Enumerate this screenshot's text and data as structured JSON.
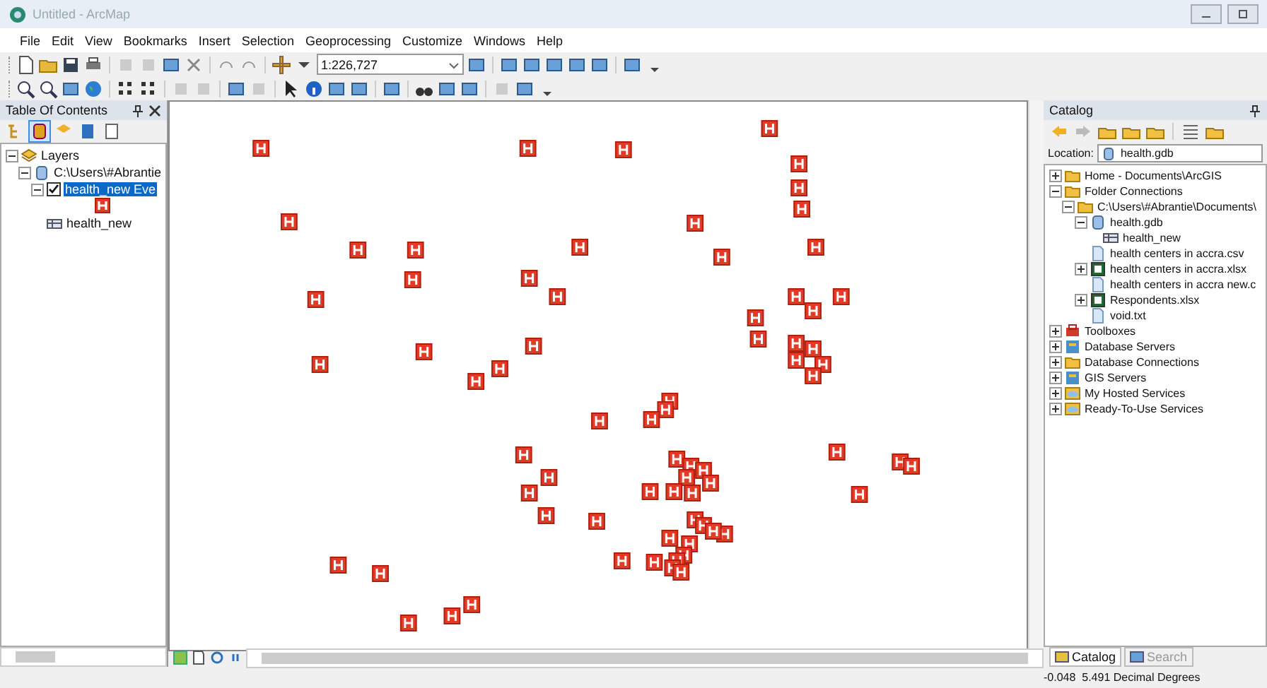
{
  "window": {
    "title": "Untitled - ArcMap"
  },
  "menu": [
    "File",
    "Edit",
    "View",
    "Bookmarks",
    "Insert",
    "Selection",
    "Geoprocessing",
    "Customize",
    "Windows",
    "Help"
  ],
  "scale_field": {
    "value": "1:226,727"
  },
  "toc": {
    "title": "Table Of Contents",
    "tree": [
      {
        "label": "Layers",
        "kind": "layers",
        "expanded": true,
        "children": [
          {
            "label": "C:\\Users\\#Abrantie",
            "kind": "gdb",
            "expanded": true,
            "children": [
              {
                "label": "health_new Eve",
                "kind": "layer",
                "expanded": true,
                "checked": true,
                "selected": true
              },
              {
                "label": "health_new",
                "kind": "table",
                "selected": false
              }
            ]
          }
        ]
      }
    ]
  },
  "catalog": {
    "title": "Catalog",
    "location_label": "Location:",
    "location_value": "health.gdb",
    "tree": [
      {
        "label": "Home - Documents\\ArcGIS",
        "kind": "folder",
        "expanded": false
      },
      {
        "label": "Folder Connections",
        "kind": "folder",
        "expanded": true,
        "children": [
          {
            "label": "C:\\Users\\#Abrantie\\Documents\\",
            "kind": "folder",
            "expanded": true,
            "children": [
              {
                "label": "health.gdb",
                "kind": "gdb",
                "expanded": true,
                "children": [
                  {
                    "label": "health_new",
                    "kind": "table"
                  }
                ]
              },
              {
                "label": "health centers in accra.csv",
                "kind": "file"
              },
              {
                "label": "health centers in accra.xlsx",
                "kind": "excel",
                "expanded": false
              },
              {
                "label": "health centers in accra new.c",
                "kind": "file"
              },
              {
                "label": "Respondents.xlsx",
                "kind": "excel",
                "expanded": false
              },
              {
                "label": "void.txt",
                "kind": "file"
              }
            ]
          }
        ]
      },
      {
        "label": "Toolboxes",
        "kind": "toolbox",
        "expanded": false
      },
      {
        "label": "Database Servers",
        "kind": "server",
        "expanded": false
      },
      {
        "label": "Database Connections",
        "kind": "folder",
        "expanded": false
      },
      {
        "label": "GIS Servers",
        "kind": "server",
        "expanded": false
      },
      {
        "label": "My Hosted Services",
        "kind": "cloud",
        "expanded": false
      },
      {
        "label": "Ready-To-Use Services",
        "kind": "cloud",
        "expanded": false
      }
    ]
  },
  "catalog_tabs": [
    {
      "label": "Catalog",
      "selected": true
    },
    {
      "label": "Search",
      "selected": false
    }
  ],
  "status_bar": {
    "coordinates": "-0.048  5.491 Decimal Degrees"
  }
}
